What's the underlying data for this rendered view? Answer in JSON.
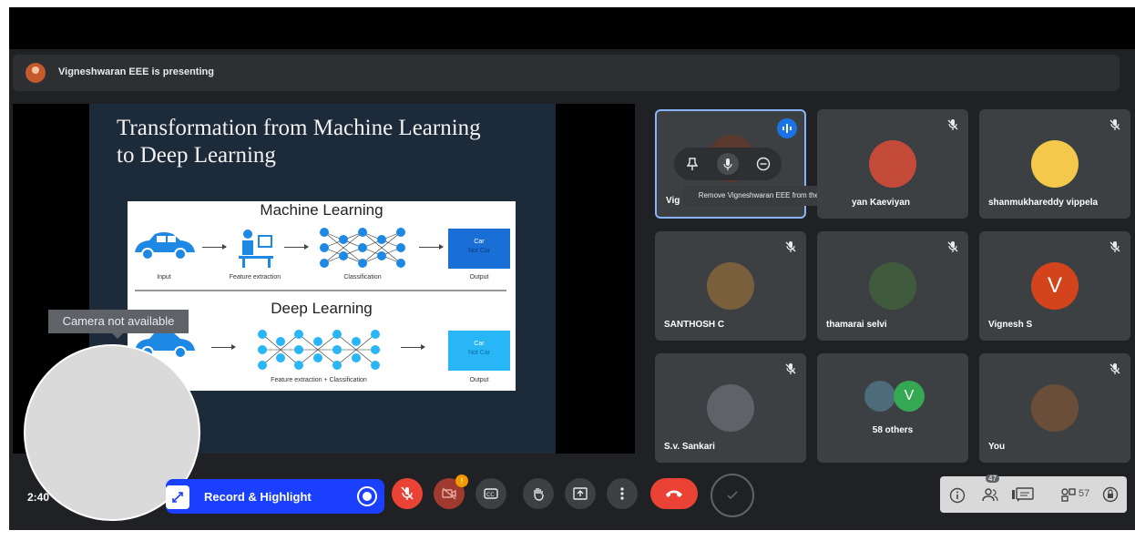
{
  "presenting": {
    "text": "Vigneshwaran EEE is presenting"
  },
  "slide": {
    "title_line1": "Transformation from Machine Learning",
    "title_line2": "to Deep Learning",
    "ml_heading": "Machine Learning",
    "dl_heading": "Deep Learning",
    "ml_input": "Input",
    "ml_feature": "Feature extraction",
    "ml_class": "Classification",
    "ml_output": "Output",
    "dl_feature_class": "Feature extraction + Classification",
    "dl_output": "Output",
    "out_car": "Car",
    "out_notcar": "Not Car",
    "colors": {
      "bg": "#1d2a3a",
      "box_dark": "#1a6fd6",
      "box_light": "#29b6f6",
      "node": "#1e88e5"
    }
  },
  "tooltip": {
    "text": "Remove Vigneshwaran EEE from the call"
  },
  "participants": [
    {
      "name": "Vig"
    },
    {
      "name": "yan Kaeviyan"
    },
    {
      "name": "shanmukhareddy vippela"
    },
    {
      "name": "SANTHOSH C"
    },
    {
      "name": "thamarai selvi"
    },
    {
      "name": "Vignesh S",
      "initial": "V"
    },
    {
      "name": "S.v. Sankari"
    },
    {
      "name": "58 others",
      "initial": "V"
    },
    {
      "name": "You"
    }
  ],
  "camera": {
    "label": "Camera not available"
  },
  "controls": {
    "time": "2:40",
    "record_label": "Record & Highlight",
    "badge": "!",
    "panel_count": "57",
    "panel_sup": "47"
  },
  "icons": [
    "speaker-icon",
    "mic-muted-icon",
    "pin-icon",
    "mic-icon",
    "remove-icon",
    "camera-off-icon",
    "captions-icon",
    "raise-hand-icon",
    "present-icon",
    "more-icon",
    "end-call-icon",
    "info-icon",
    "people-icon",
    "chat-icon",
    "activities-icon",
    "lock-icon",
    "expand-icon"
  ],
  "accent": {
    "red": "#ea4335",
    "blue": "#1a3fff",
    "google_blue": "#4285f4"
  }
}
